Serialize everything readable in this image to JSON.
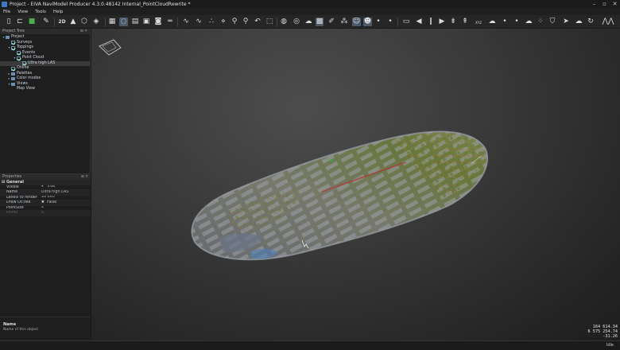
{
  "window": {
    "title": "Project - EIVA NaviModel Producer 4.3.0.48142 Internal_PointCloudRewrite *"
  },
  "menu": [
    "File",
    "View",
    "Tools",
    "Help"
  ],
  "toolbar_labels": {
    "two_d": "2D",
    "xyz": "XYZ"
  },
  "project_tree": {
    "header": "Project Tree",
    "items": [
      {
        "label": "Project",
        "level": 0,
        "type": "folder",
        "arrow": "▾"
      },
      {
        "label": "Surveys",
        "level": 1,
        "type": "check",
        "checked": true
      },
      {
        "label": "Toppings",
        "level": 1,
        "type": "check",
        "checked": true,
        "arrow": "▾"
      },
      {
        "label": "Events",
        "level": 2,
        "type": "check",
        "checked": true
      },
      {
        "label": "Point Cloud",
        "level": 2,
        "type": "check",
        "checked": true,
        "arrow": "▾"
      },
      {
        "label": "Ultra high LAS",
        "level": 3,
        "type": "check",
        "checked": true,
        "selected": true
      },
      {
        "label": "Online",
        "level": 1,
        "type": "check",
        "checked": true
      },
      {
        "label": "Palettes",
        "level": 1,
        "type": "folder",
        "arrow": "▸"
      },
      {
        "label": "Color modes",
        "level": 1,
        "type": "folder",
        "arrow": "▸"
      },
      {
        "label": "Views",
        "level": 1,
        "type": "folder",
        "arrow": "▾"
      },
      {
        "label": "Map View",
        "level": 2,
        "type": "none"
      }
    ]
  },
  "properties": {
    "header": "Properties",
    "group": "General",
    "rows": [
      {
        "key": "Visible",
        "value": "True",
        "icon": "✔"
      },
      {
        "key": "Name",
        "value": "Ultra high LAS"
      },
      {
        "key": "Levels to render",
        "value": "10 000"
      },
      {
        "key": "Draw OcTree",
        "value": "False",
        "icon": "✖"
      },
      {
        "key": "PointSize",
        "value": "2"
      },
      {
        "key": "Points",
        "value": "0",
        "dim": true
      }
    ]
  },
  "description": {
    "name": "Name",
    "text": "Name of this object"
  },
  "viewport": {
    "coordinates": [
      "164 614.34",
      "6 575 254.74",
      "-31.26"
    ]
  },
  "status": {
    "state": "Idle"
  }
}
